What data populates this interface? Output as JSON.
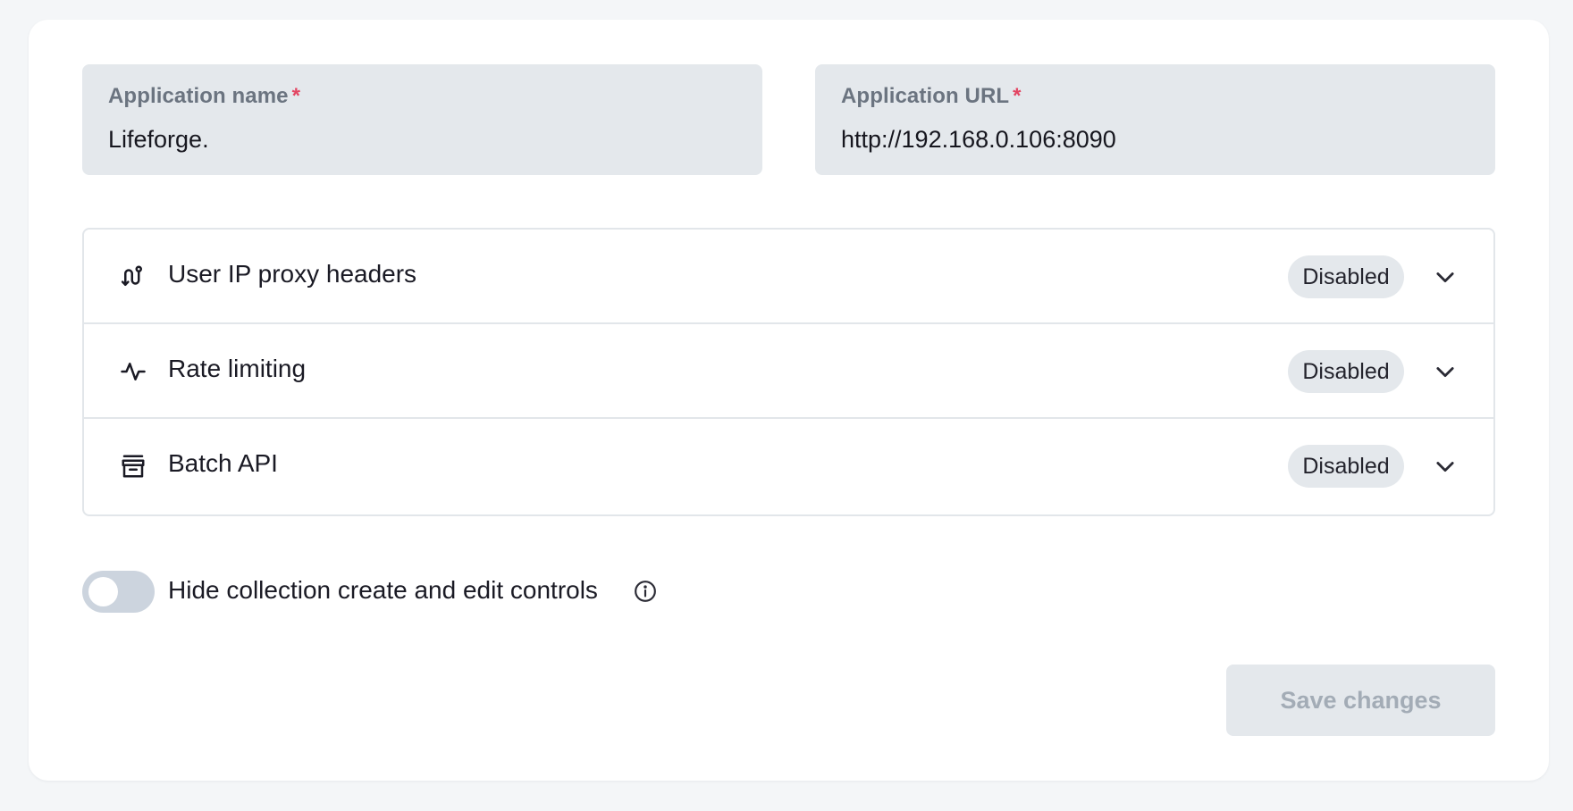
{
  "form": {
    "app_name": {
      "label": "Application name",
      "required_mark": "*",
      "value": "Lifeforge."
    },
    "app_url": {
      "label": "Application URL",
      "required_mark": "*",
      "value": "http://192.168.0.106:8090"
    }
  },
  "accordion": [
    {
      "title": "User IP proxy headers",
      "status": "Disabled",
      "icon": "route-icon"
    },
    {
      "title": "Rate limiting",
      "status": "Disabled",
      "icon": "pulse-icon"
    },
    {
      "title": "Batch API",
      "status": "Disabled",
      "icon": "archive-icon"
    }
  ],
  "toggle": {
    "label": "Hide collection create and edit controls",
    "checked": false
  },
  "actions": {
    "save_label": "Save changes"
  },
  "colors": {
    "field_bg": "#e4e8ec",
    "required": "#e34562",
    "toggle_off": "#ccd4de",
    "button_disabled_text": "#a3acb6"
  }
}
